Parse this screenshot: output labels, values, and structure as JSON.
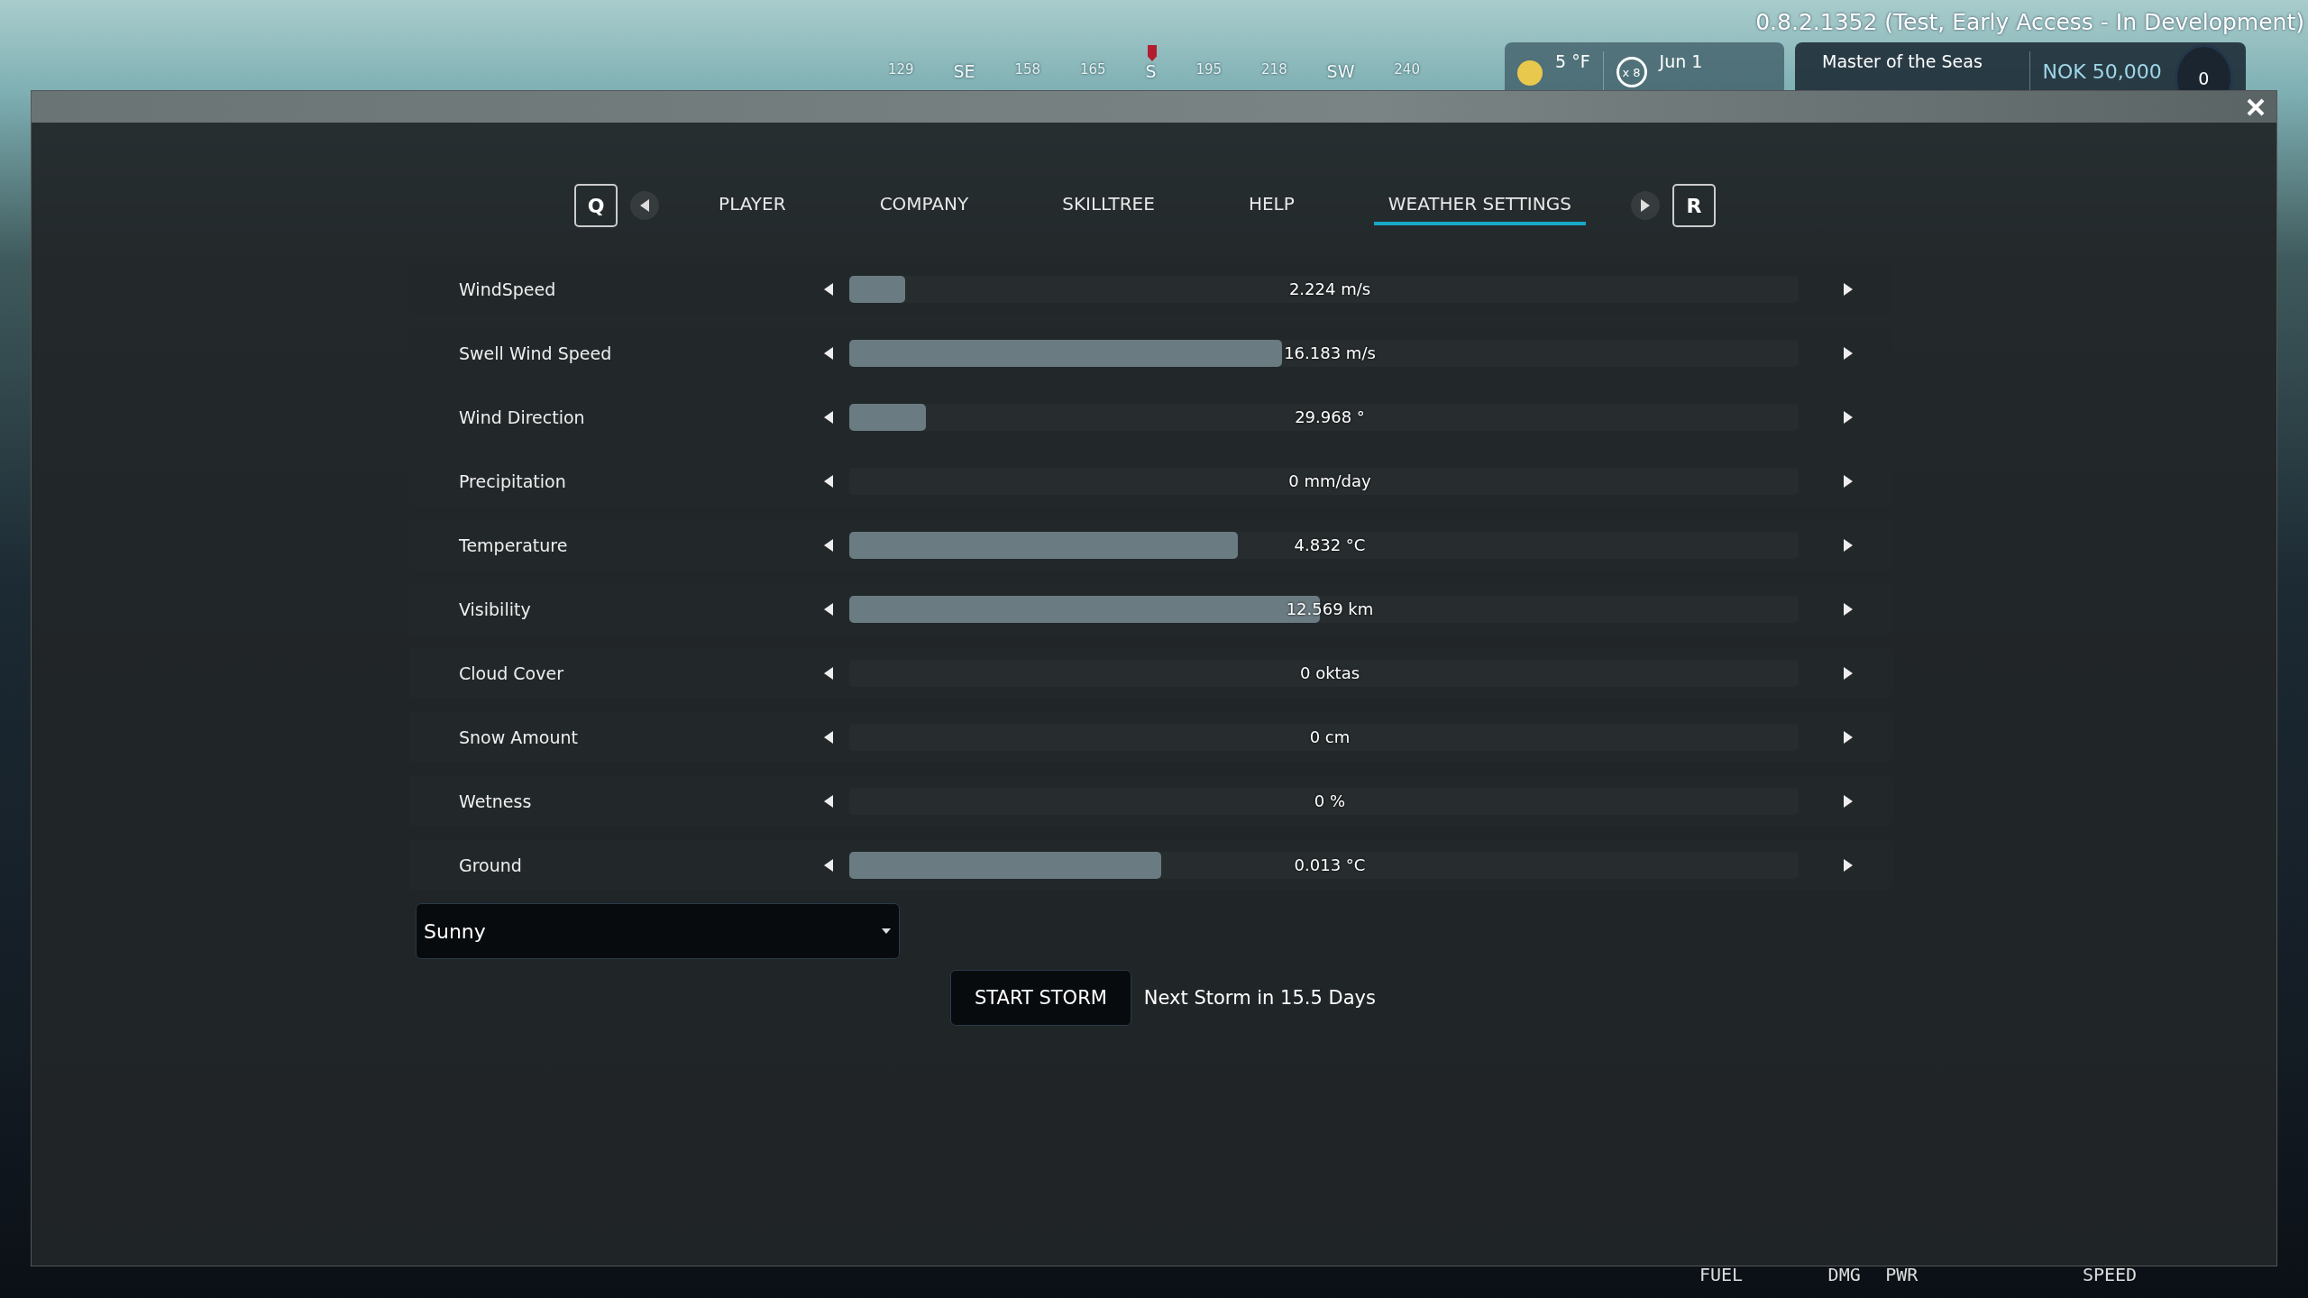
{
  "version": "0.8.2.1352 (Test, Early Access - In Development)",
  "compass": {
    "labels": [
      "129",
      "SE",
      "158",
      "165",
      "S",
      "195",
      "218",
      "SW",
      "240"
    ]
  },
  "weather_card": {
    "temperature": "5 °F",
    "time_multiplier": "x 8",
    "date": "Jun 1"
  },
  "profile_card": {
    "title": "Master of the Seas",
    "money": "NOK 50,000",
    "count": "0"
  },
  "tabs": {
    "prev_key": "Q",
    "next_key": "R",
    "items": [
      {
        "label": "PLAYER",
        "selected": false
      },
      {
        "label": "COMPANY",
        "selected": false
      },
      {
        "label": "SKILLTREE",
        "selected": false
      },
      {
        "label": "HELP",
        "selected": false
      },
      {
        "label": "WEATHER SETTINGS",
        "selected": true
      }
    ]
  },
  "settings": [
    {
      "name": "WindSpeed",
      "level": 0.059,
      "reading": "2.224 m/s"
    },
    {
      "name": "Swell Wind Speed",
      "level": 0.456,
      "reading": "16.183 m/s"
    },
    {
      "name": "Wind Direction",
      "level": 0.081,
      "reading": "29.968 °"
    },
    {
      "name": "Precipitation",
      "reading": "0 mm/day"
    },
    {
      "name": "Temperature",
      "level": 0.409,
      "reading": "4.832 °C"
    },
    {
      "name": "Visibility",
      "level": 0.496,
      "reading": "12.569 km"
    },
    {
      "name": "Cloud Cover",
      "reading": "0 oktas"
    },
    {
      "name": "Snow Amount",
      "reading": "0 cm"
    },
    {
      "name": "Wetness",
      "reading": "0 %"
    },
    {
      "name": "Ground",
      "level": 0.329,
      "reading": "0.013 °C"
    }
  ],
  "weather_preset": {
    "value": "Sunny"
  },
  "storm": {
    "button": "START STORM",
    "status": "Next Storm in 15.5 Days"
  },
  "gauges": [
    "FUEL",
    "DMG",
    "PWR",
    "SPEED"
  ]
}
